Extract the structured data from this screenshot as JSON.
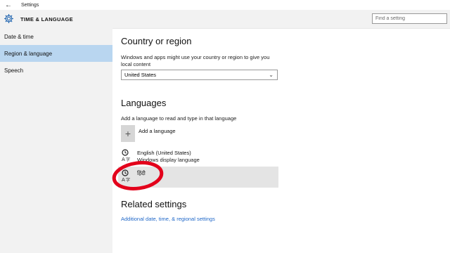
{
  "window": {
    "title": "Settings"
  },
  "header": {
    "title": "TIME & LANGUAGE",
    "search_placeholder": "Find a setting"
  },
  "sidebar": {
    "items": [
      {
        "label": "Date & time"
      },
      {
        "label": "Region & language",
        "selected": true
      },
      {
        "label": "Speech"
      }
    ]
  },
  "country": {
    "heading": "Country or region",
    "description_line1": "Windows and apps might use your country or region to give you",
    "description_line2": "local content",
    "selected_value": "United States"
  },
  "languages": {
    "heading": "Languages",
    "description": "Add a language to read and type in that language",
    "add_label": "Add a language",
    "items": [
      {
        "name": "English (United States)",
        "subtitle": "Windows display language"
      },
      {
        "name": "हिंदी",
        "subtitle": "",
        "selected": true
      }
    ]
  },
  "related": {
    "heading": "Related settings",
    "link": "Additional date, time, & regional settings"
  },
  "colors": {
    "accent": "#2b6cb3",
    "sidebar_bg": "#f2f2f2",
    "selected_nav": "#b9d6f0",
    "link": "#1f67c8",
    "annotation": "#e3001b"
  }
}
